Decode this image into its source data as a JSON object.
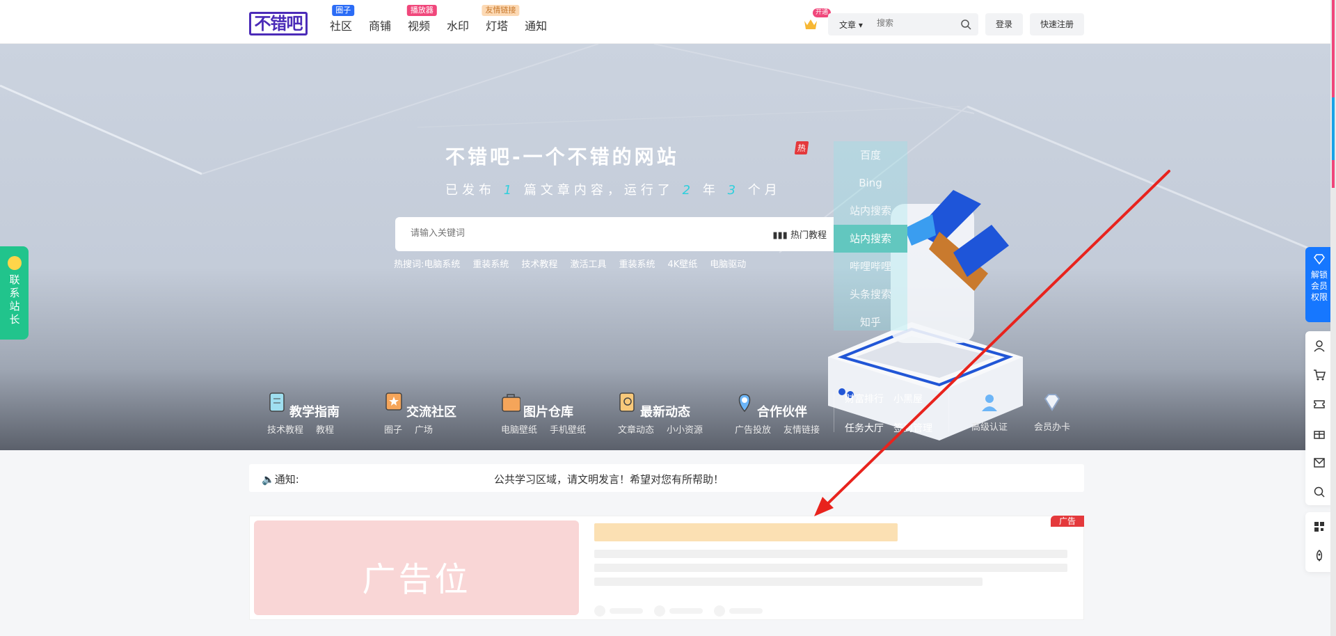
{
  "header": {
    "logo": "不错吧",
    "nav": [
      {
        "label": "社区",
        "badge": "圈子",
        "badge_style": "blue"
      },
      {
        "label": "商铺",
        "badge": ""
      },
      {
        "label": "视频",
        "badge": "播放器",
        "badge_style": "pink"
      },
      {
        "label": "水印",
        "badge": ""
      },
      {
        "label": "灯塔",
        "badge": "友情链接",
        "badge_style": "peach"
      },
      {
        "label": "通知",
        "badge": ""
      }
    ],
    "vip_badge": "开通",
    "search_type": "文章",
    "search_placeholder": "搜索",
    "login": "登录",
    "register": "快速注册"
  },
  "hero": {
    "title": "不错吧-一个不错的网站",
    "sub_prefix": "已发布",
    "articles": "1",
    "sub_mid": "篇文章内容，运行了",
    "years": "2",
    "year_unit": "年",
    "months": "3",
    "month_unit": "个月",
    "hot_badge": "热",
    "search_placeholder": "请输入关键词",
    "hot_tutorial": "热门教程",
    "hot_words_label": "热搜词:",
    "hot_words": [
      "电脑系统",
      "重装系统",
      "技术教程",
      "激活工具",
      "重装系统",
      "4K壁纸",
      "电脑驱动"
    ],
    "engines": [
      "百度",
      "Bing",
      "站内搜索",
      "站内搜索",
      "哔哩哔哩",
      "头条搜索",
      "知乎"
    ],
    "active_engine_index": 3
  },
  "categories": [
    {
      "title": "教学指南",
      "links": [
        "技术教程",
        "教程"
      ],
      "icon": "book-icon"
    },
    {
      "title": "交流社区",
      "links": [
        "圈子",
        "广场"
      ],
      "icon": "star-icon"
    },
    {
      "title": "图片仓库",
      "links": [
        "电脑壁纸",
        "手机壁纸"
      ],
      "icon": "bag-icon"
    },
    {
      "title": "最新动态",
      "links": [
        "文章动态",
        "小小资源"
      ],
      "icon": "doc-search-icon"
    },
    {
      "title": "合作伙伴",
      "links": [
        "广告投放",
        "友情链接"
      ],
      "icon": "location-icon"
    }
  ],
  "extra_links": {
    "row1": [
      "财富排行",
      "小黑屋"
    ],
    "row2": [
      "任务大厅",
      "签到管理"
    ]
  },
  "badges": [
    {
      "label": "高级认证",
      "icon": "user-badge-icon"
    },
    {
      "label": "会员办卡",
      "icon": "diamond-icon"
    }
  ],
  "contact": {
    "label": "联系站长"
  },
  "right_vip": {
    "label": "解锁会员权限"
  },
  "right_tools": [
    "user-icon",
    "cart-icon",
    "ticket-icon",
    "gift-icon",
    "mail-icon",
    "search-icon"
  ],
  "right_tools2": [
    "qrcode-icon",
    "rocket-icon"
  ],
  "notice": {
    "label": "通知:",
    "text": "公共学习区域，请文明发言！希望对您有所帮助！"
  },
  "ad": {
    "image_text": "广告位",
    "tag": "广告"
  },
  "colors": {
    "accent": "#1677ff",
    "contact": "#21c48c",
    "arrow": "#e8231d",
    "highlight_num": "#2fcfdc"
  }
}
